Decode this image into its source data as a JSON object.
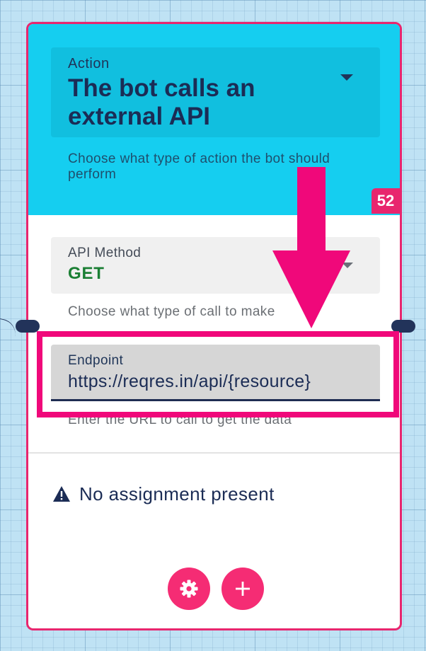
{
  "action": {
    "label": "Action",
    "value": "The bot calls an external API",
    "helper": "Choose what type of action the bot should perform"
  },
  "node_number": "52",
  "api_method": {
    "label": "API Method",
    "value": "GET",
    "helper": "Choose what type of call to make"
  },
  "endpoint": {
    "label": "Endpoint",
    "value": "https://reqres.in/api/{resource}",
    "helper": "Enter the URL to call to get the data"
  },
  "assignment": {
    "warning_text": "No assignment present"
  },
  "buttons": {
    "settings_icon": "gear-icon",
    "add_icon": "plus-icon"
  },
  "colors": {
    "header_bg": "#15cef0",
    "accent": "#e8266e",
    "method_green": "#1b7f34",
    "navy": "#1b2c55"
  }
}
